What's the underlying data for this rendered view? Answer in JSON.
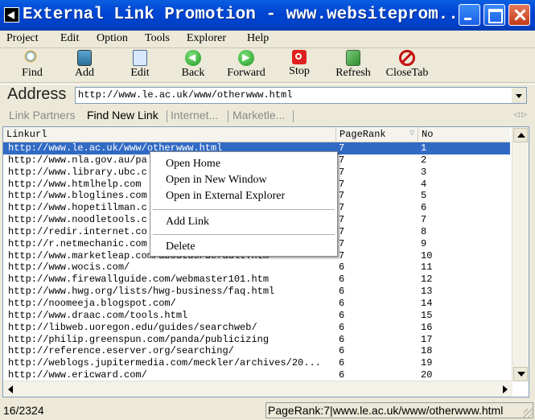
{
  "window": {
    "title": "External Link Promotion - www.websiteprom..."
  },
  "menu": [
    "Project",
    "Edit",
    "Option",
    "Tools",
    "Explorer",
    "Help"
  ],
  "toolbar": [
    {
      "label": "Find",
      "icon": "magnifier-icon"
    },
    {
      "label": "Add",
      "icon": "add-page-icon"
    },
    {
      "label": "Edit",
      "icon": "edit-page-icon"
    },
    {
      "label": "Back",
      "icon": "back-arrow-icon"
    },
    {
      "label": "Forward",
      "icon": "forward-arrow-icon"
    },
    {
      "label": "Stop",
      "icon": "stop-icon"
    },
    {
      "label": "Refresh",
      "icon": "refresh-icon"
    },
    {
      "label": "CloseTab",
      "icon": "close-tab-icon"
    }
  ],
  "address": {
    "label": "Address",
    "value": "http://www.le.ac.uk/www/otherwww.html"
  },
  "tabs": [
    "Link Partners",
    "Find New Link",
    "Internet...",
    "Marketle..."
  ],
  "table": {
    "columns": [
      "Linkurl",
      "PageRank",
      "No"
    ],
    "rows": [
      {
        "url": "http://www.le.ac.uk/www/otherwww.html",
        "pr": "7",
        "no": "1"
      },
      {
        "url": "http://www.nla.gov.au/pa",
        "pr": "7",
        "no": "2"
      },
      {
        "url": "http://www.library.ubc.c",
        "pr": "7",
        "no": "3"
      },
      {
        "url": "http://www.htmlhelp.com",
        "pr": "7",
        "no": "4"
      },
      {
        "url": "http://www.bloglines.com",
        "pr": "7",
        "no": "5"
      },
      {
        "url": "http://www.hopetillman.c",
        "pr": "7",
        "no": "6"
      },
      {
        "url": "http://www.noodletools.c",
        "pr": "7",
        "no": "7"
      },
      {
        "url": "http://redir.internet.co",
        "pr": "7",
        "no": "8"
      },
      {
        "url": "http://r.netmechanic.com",
        "pr": "7",
        "no": "9"
      },
      {
        "url": "http://www.marketleap.com/aboutus/default.htm",
        "pr": "7",
        "no": "10"
      },
      {
        "url": "http://www.wocis.com/",
        "pr": "6",
        "no": "11"
      },
      {
        "url": "http://www.firewallguide.com/webmaster101.htm",
        "pr": "6",
        "no": "12"
      },
      {
        "url": "http://www.hwg.org/lists/hwg-business/faq.html",
        "pr": "6",
        "no": "13"
      },
      {
        "url": "http://noomeeja.blogspot.com/",
        "pr": "6",
        "no": "14"
      },
      {
        "url": "http://www.draac.com/tools.html",
        "pr": "6",
        "no": "15"
      },
      {
        "url": "http://libweb.uoregon.edu/guides/searchweb/",
        "pr": "6",
        "no": "16"
      },
      {
        "url": "http://philip.greenspun.com/panda/publicizing",
        "pr": "6",
        "no": "17"
      },
      {
        "url": "http://reference.eserver.org/searching/",
        "pr": "6",
        "no": "18"
      },
      {
        "url": "http://weblogs.jupitermedia.com/meckler/archives/20...",
        "pr": "6",
        "no": "19"
      },
      {
        "url": "http://www.ericward.com/",
        "pr": "6",
        "no": "20"
      }
    ]
  },
  "context_menu": [
    "Open Home",
    "Open in New Window",
    "Open in External Explorer",
    "Add Link",
    "Delete"
  ],
  "status": {
    "count": "16/2324",
    "detail": "PageRank:7|www.le.ac.uk/www/otherwww.html"
  }
}
